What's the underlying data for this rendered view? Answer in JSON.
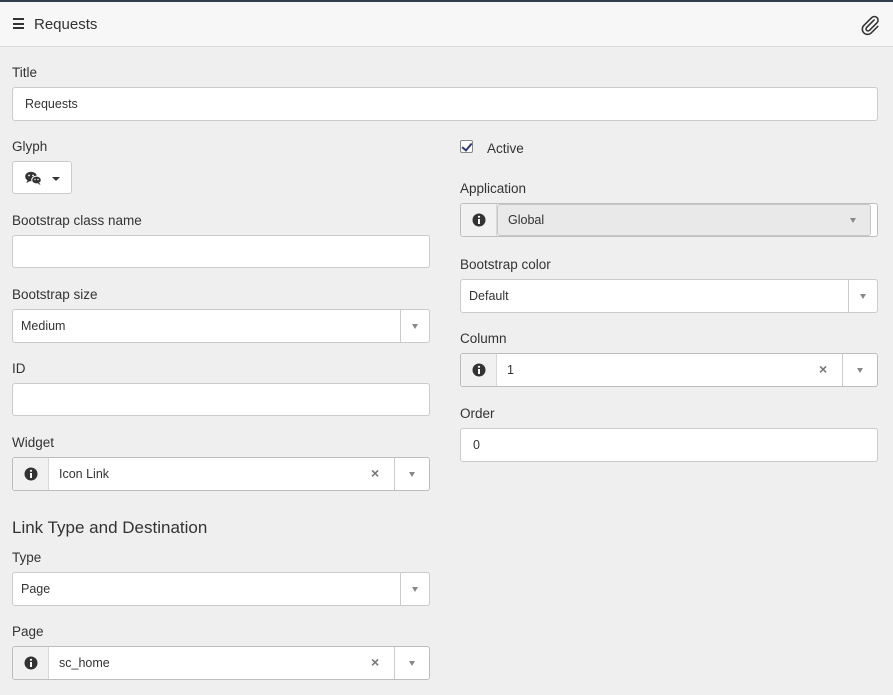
{
  "header": {
    "title": "Requests"
  },
  "form": {
    "title": {
      "label": "Title",
      "value": "Requests"
    },
    "glyph": {
      "label": "Glyph",
      "icon": "wechat-icon"
    },
    "active": {
      "label": "Active",
      "checked": true
    },
    "application": {
      "label": "Application",
      "value": "Global"
    },
    "bootstrap_class_name": {
      "label": "Bootstrap class name",
      "value": ""
    },
    "bootstrap_color": {
      "label": "Bootstrap color",
      "value": "Default"
    },
    "bootstrap_size": {
      "label": "Bootstrap size",
      "value": "Medium"
    },
    "column": {
      "label": "Column",
      "value": "1"
    },
    "id": {
      "label": "ID",
      "value": ""
    },
    "order": {
      "label": "Order",
      "value": "0"
    },
    "widget": {
      "label": "Widget",
      "value": "Icon Link"
    },
    "link_section": {
      "title": "Link Type and Destination"
    },
    "type": {
      "label": "Type",
      "value": "Page"
    },
    "page": {
      "label": "Page",
      "value": "sc_home"
    }
  },
  "icons": {
    "menu": "menu-icon",
    "attachment": "paperclip-icon",
    "info": "info-icon",
    "clear": "clear-icon",
    "dropdown": "chevron-down-icon"
  },
  "colors": {
    "topline": "#2f3e4a",
    "background": "#efefef",
    "checkmark": "#2d3b75"
  }
}
